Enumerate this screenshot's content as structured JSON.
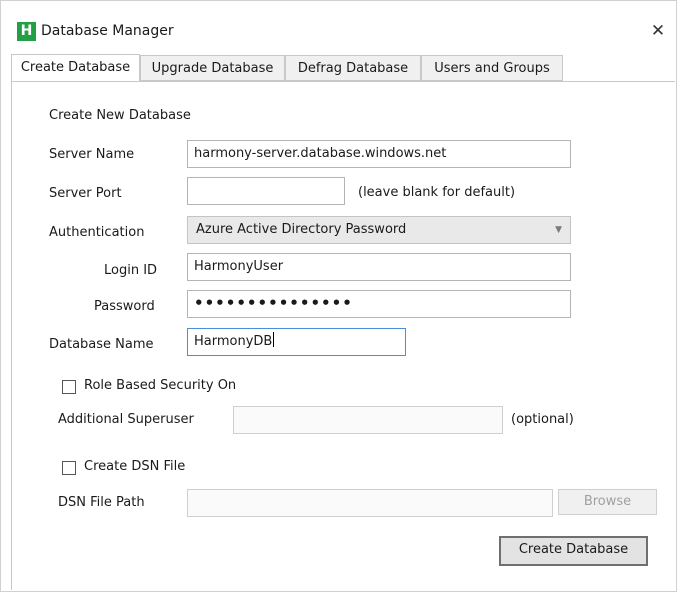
{
  "window": {
    "title": "Database Manager",
    "app_icon_letter": "H",
    "close_glyph": "✕",
    "colors": {
      "app_icon": "#23a045",
      "focus_border": "#4a90d9"
    }
  },
  "tabs": [
    {
      "label": "Create Database",
      "active": true
    },
    {
      "label": "Upgrade Database",
      "active": false
    },
    {
      "label": "Defrag Database",
      "active": false
    },
    {
      "label": "Users and Groups",
      "active": false
    }
  ],
  "form": {
    "section_title": "Create New Database",
    "server_name": {
      "label": "Server Name",
      "value": "harmony-server.database.windows.net"
    },
    "server_port": {
      "label": "Server Port",
      "value": "",
      "hint": "(leave blank for default)"
    },
    "authentication": {
      "label": "Authentication",
      "selected": "Azure Active Directory Password",
      "arrow": "▼"
    },
    "login_id": {
      "label": "Login ID",
      "value": "HarmonyUser"
    },
    "password": {
      "label": "Password",
      "masked_value": "•••••••••••••••"
    },
    "database_name": {
      "label": "Database Name",
      "value": "HarmonyDB"
    },
    "role_based_security": {
      "label": "Role Based Security On",
      "checked": false
    },
    "additional_superuser": {
      "label": "Additional Superuser",
      "value": "",
      "hint": "(optional)"
    },
    "create_dsn_file": {
      "label": "Create DSN File",
      "checked": false
    },
    "dsn_file_path": {
      "label": "DSN File Path",
      "value": "",
      "browse_label": "Browse"
    },
    "submit_label": "Create Database"
  }
}
